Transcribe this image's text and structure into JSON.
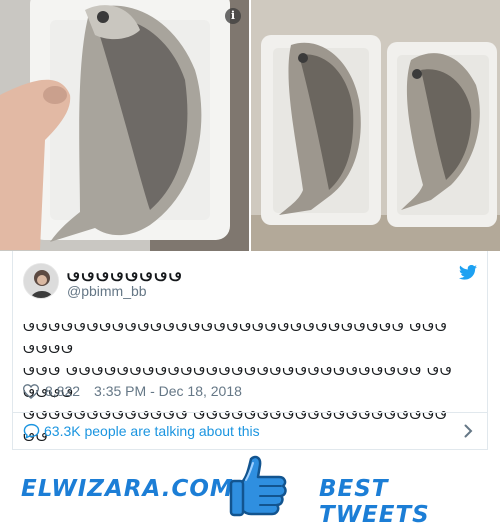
{
  "tweet": {
    "display_name": "𖼥𖼥𖼥𖼥𖼥𖼥𖼥𖼥",
    "handle": "@pbimm_bb",
    "text_lines": [
      "𖼥𖼥𖼥𖼥𖼥𖼥𖼥𖼥𖼥𖼥𖼥𖼥𖼥𖼥𖼥𖼥𖼥𖼥𖼥𖼥𖼥𖼥𖼥𖼥𖼥𖼥𖼥𖼥𖼥𖼥 𖼥𖼥𖼥𖼥𖼥𖼥𖼥",
      "𖼥𖼥𖼥 𖼥𖼥𖼥𖼥𖼥𖼥𖼥𖼥𖼥𖼥𖼥𖼥𖼥𖼥𖼥𖼥𖼥𖼥𖼥𖼥𖼥𖼥𖼥𖼥𖼥𖼥𖼥𖼥 𖼥𖼥𖼥𖼥𖼥𖼥",
      "𖼥𖼥𖼥𖼥𖼥𖼥𖼥𖼥𖼥𖼥𖼥𖼥𖼥 𖼥𖼥𖼥𖼥𖼥𖼥𖼥𖼥𖼥𖼥𖼥𖼥𖼥𖼥𖼥𖼥𖼥𖼥𖼥𖼥𖼥𖼥"
    ],
    "like_count": "8,822",
    "timestamp": "3:35 PM - Dec 18, 2018",
    "conversation_text": "63.3K people are talking about this"
  },
  "banner": {
    "brand": "ELWIZARA.COM",
    "best": "BEST TWEETS"
  },
  "colors": {
    "link": "#1b95e0",
    "brand": "#1c7ed6",
    "muted": "#657786"
  },
  "icons": [
    "info-icon",
    "twitter-bird-icon",
    "heart-icon",
    "speech-bubble-icon",
    "chevron-right-icon",
    "thumbs-up-icon"
  ]
}
